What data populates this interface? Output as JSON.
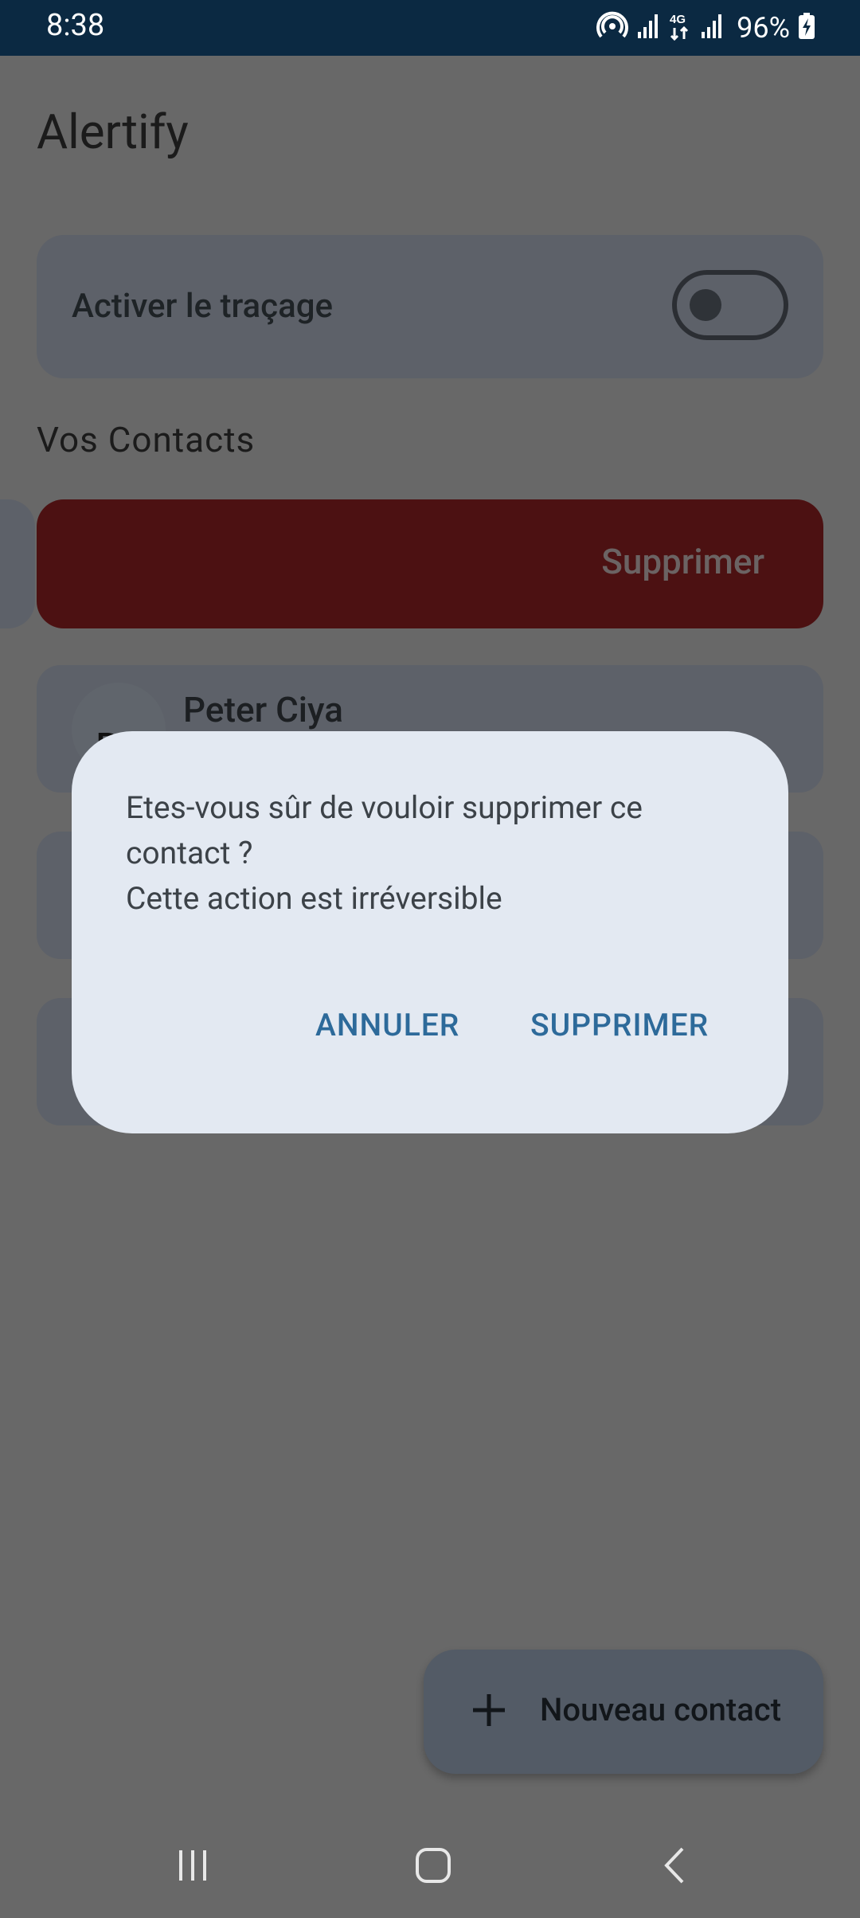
{
  "status_bar": {
    "time": "8:38",
    "network": "4G",
    "battery": "96%",
    "icons": [
      "hotspot-icon",
      "signal-icon",
      "data-4g-icon",
      "signal-icon",
      "battery-charging-icon"
    ]
  },
  "app": {
    "title": "Alertify"
  },
  "tracking": {
    "label": "Activer le traçage",
    "enabled": false
  },
  "contacts": {
    "section_title": "Vos Contacts",
    "swipe_action_label": "Supprimer",
    "items": [
      {
        "initials": "PC",
        "name": "Peter Ciya"
      },
      {
        "initials": "",
        "name": ""
      },
      {
        "initials": "",
        "name": ""
      }
    ]
  },
  "dialog": {
    "message_line1": "Etes-vous sûr de vouloir supprimer ce contact ?",
    "message_line2": "Cette action est irréversible",
    "cancel_label": "ANNULER",
    "confirm_label": "SUPPRIMER"
  },
  "fab": {
    "icon": "plus-icon",
    "label": "Nouveau contact"
  },
  "nav_bar": {
    "icons": [
      "recent-apps-icon",
      "home-icon",
      "back-icon"
    ]
  },
  "colors": {
    "status_bar": "#0b2942",
    "scrim_bg": "#686868",
    "dialog_bg": "#e3e9f2",
    "accent": "#2d6a9a",
    "delete_red": "#4c1112"
  }
}
